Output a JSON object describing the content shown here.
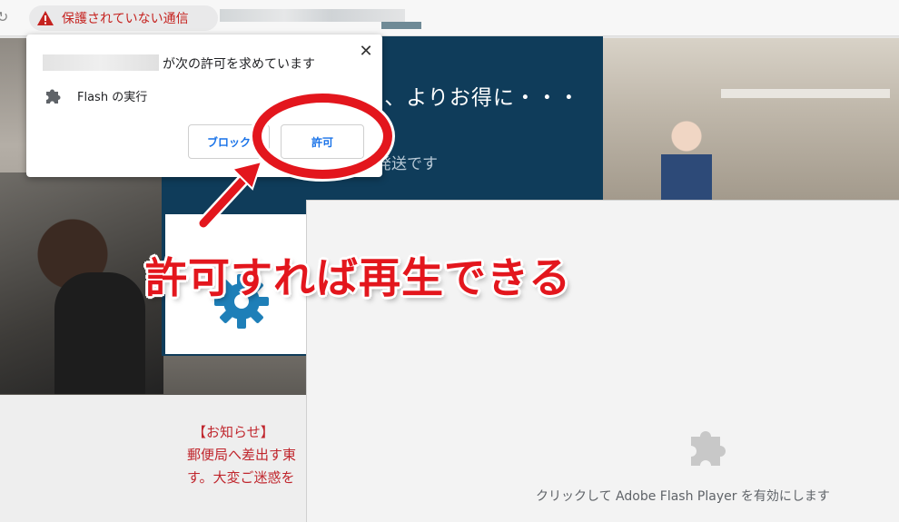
{
  "browser": {
    "security_label": "保護されていない通信",
    "warning_color": "#c5221f",
    "reload_icon": "reload-icon",
    "warning_icon": "warning-icon"
  },
  "page": {
    "headline": "に、よりお得に・・・",
    "subline": "それが私たち東京発送です",
    "notice_title": "【お知らせ】",
    "notice_line1": "郵便局へ差出す東",
    "notice_line2": "す。大変ご迷惑を",
    "navy_color": "#0f3c5a",
    "notice_color": "#c0262d"
  },
  "permission_popup": {
    "title": "が次の許可を求めています",
    "permission_label": "Flash の実行",
    "block_label": "ブロック",
    "allow_label": "許可",
    "close_icon": "close-icon",
    "plugin_icon": "puzzle-icon",
    "button_color": "#1a73e8"
  },
  "flash": {
    "message": "クリックして Adobe Flash Player を有効にします",
    "plugin_icon": "puzzle-icon"
  },
  "annotation": {
    "callout": "許可すれば再生できる",
    "color": "#e3161d"
  }
}
